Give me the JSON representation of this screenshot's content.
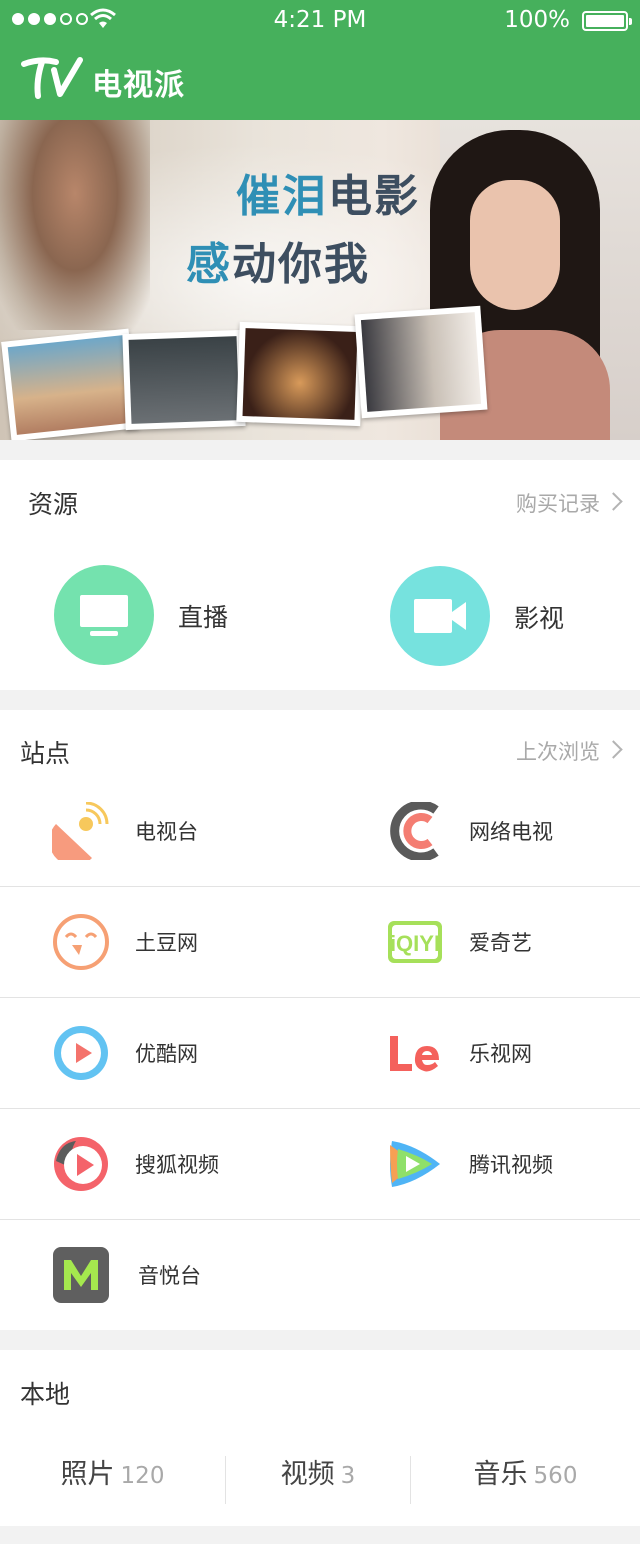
{
  "status_bar": {
    "time": "4:21 PM",
    "battery": "100%"
  },
  "app": {
    "title": "电视派"
  },
  "banner": {
    "line1_a": "催泪",
    "line1_b": "电影",
    "line2_a": "感",
    "line2_b": "动你我"
  },
  "resources": {
    "title": "资源",
    "link": "购买记录",
    "items": [
      {
        "label": "直播",
        "icon": "tv-icon",
        "color": "#74e2ae"
      },
      {
        "label": "影视",
        "icon": "video-camera-icon",
        "color": "#76e2de"
      }
    ]
  },
  "sites": {
    "title": "站点",
    "link": "上次浏览",
    "items": [
      {
        "label": "电视台",
        "icon": "satellite-dish-icon"
      },
      {
        "label": "网络电视",
        "icon": "network-tv-icon"
      },
      {
        "label": "土豆网",
        "icon": "tudou-icon"
      },
      {
        "label": "爱奇艺",
        "icon": "iqiyi-icon"
      },
      {
        "label": "优酷网",
        "icon": "youku-icon"
      },
      {
        "label": "乐视网",
        "icon": "letv-icon"
      },
      {
        "label": "搜狐视频",
        "icon": "sohu-video-icon"
      },
      {
        "label": "腾讯视频",
        "icon": "tencent-video-icon"
      },
      {
        "label": "音悦台",
        "icon": "yinyuetai-icon"
      }
    ]
  },
  "local": {
    "title": "本地",
    "items": [
      {
        "label": "照片",
        "count": "120"
      },
      {
        "label": "视频",
        "count": "3"
      },
      {
        "label": "音乐",
        "count": "560"
      }
    ]
  }
}
